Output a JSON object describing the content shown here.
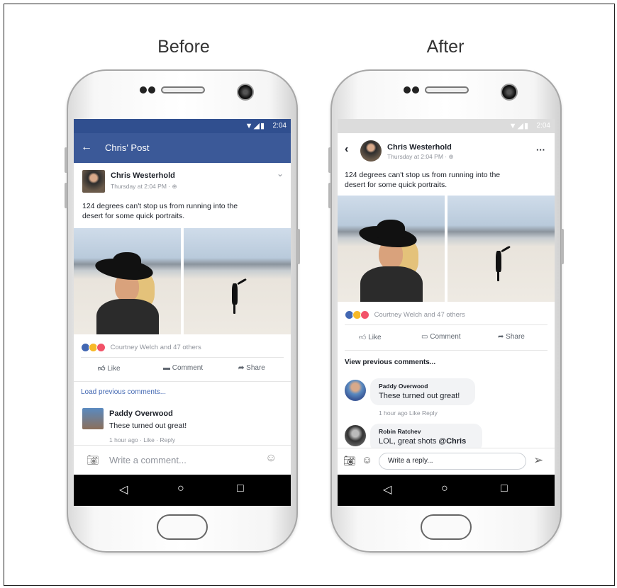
{
  "captions": {
    "before": "Before",
    "after": "After"
  },
  "status": {
    "time": "2:04",
    "icons": "▼◢▮"
  },
  "before": {
    "header_title": "Chris' Post",
    "back_icon": "←",
    "author": "Chris Westerhold",
    "timestamp": "Thursday at 2:04 PM · ⊕",
    "post_text_line1": "124 degrees can't stop us from running into the",
    "post_text_line2": "desert for some quick portraits.",
    "reactions_text": "Courtney Welch and 47 others",
    "like": "Like",
    "comment": "Comment",
    "share": "Share",
    "load_previous": "Load previous comments...",
    "commenter": "Paddy Overwood",
    "comment_text": "These turned out great!",
    "comment_meta": "1 hour ago  ·  Like  ·  Reply",
    "composer_placeholder": "Write a comment...",
    "chevron": "⌄"
  },
  "after": {
    "author": "Chris Westerhold",
    "timestamp": "Thursday at 2:04 PM · ⊕",
    "more": "···",
    "post_text_line1": "124 degrees can't stop us from running into the",
    "post_text_line2": "desert for some quick portraits.",
    "reactions_text": "Courtney Welch and 47 others",
    "like": "Like",
    "comment": "Comment",
    "share": "Share",
    "view_previous": "View previous comments...",
    "commenter1": "Paddy Overwood",
    "comment1": "These turned out great!",
    "comment1_meta": "1 hour ago   Like   Reply",
    "commenter2": "Robin Ratchev",
    "comment2_prefix": "LOL, great shots ",
    "comment2_mention": "@Chris",
    "reply_placeholder": "Write a reply..."
  },
  "nav": {
    "back": "◁",
    "home": "○",
    "recent": "□"
  },
  "colors": {
    "fb_blue": "#3b5998",
    "link_blue": "#4267b2",
    "love_red": "#f25268",
    "wow_yellow": "#f7b928"
  }
}
